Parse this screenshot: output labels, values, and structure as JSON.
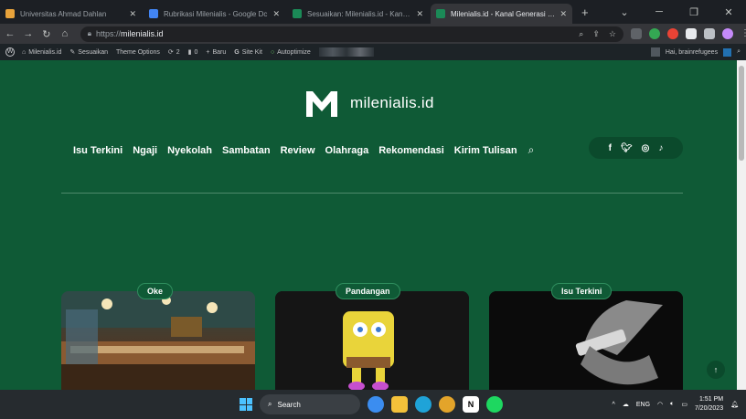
{
  "browser": {
    "tabs": [
      {
        "label": "Universitas Ahmad Dahlan",
        "favicon_color": "#e8a33b",
        "active": false
      },
      {
        "label": "Rubrikasi Milenialis - Google Dc",
        "favicon_color": "#4285f4",
        "active": false
      },
      {
        "label": "Sesuaikan: Milenialis.id - Kanal G",
        "favicon_color": "#1b8a57",
        "active": false
      },
      {
        "label": "Milenialis.id - Kanal Generasi Mu",
        "favicon_color": "#1b8a57",
        "active": true
      }
    ],
    "new_tab": "+",
    "url_prefix": "https://",
    "url_host": "milenialis.id"
  },
  "wp_admin_bar": {
    "site_name": "Milenialis.id",
    "items": [
      "Sesuaikan",
      "Theme Options",
      "2",
      "0",
      "Baru",
      "Site Kit",
      "Autoptimize"
    ],
    "greeting": "Hai, brainrefugees"
  },
  "site": {
    "logo_text": "milenialis.id",
    "nav": [
      "Isu Terkini",
      "Ngaji",
      "Nyekolah",
      "Sambatan",
      "Review",
      "Olahraga",
      "Rekomendasi",
      "Kirim Tulisan"
    ],
    "social_icons": [
      "f",
      "twitter-bird",
      "instagram",
      "tiktok"
    ],
    "cards": [
      {
        "category": "Oke"
      },
      {
        "category": "Pandangan"
      },
      {
        "category": "Isu Terkini"
      }
    ],
    "brand_color": "#0f5a36",
    "scroll_top": "↑"
  },
  "taskbar": {
    "search_label": "Search",
    "lang": "ENG",
    "time": "1:51 PM",
    "date": "7/20/2023"
  }
}
